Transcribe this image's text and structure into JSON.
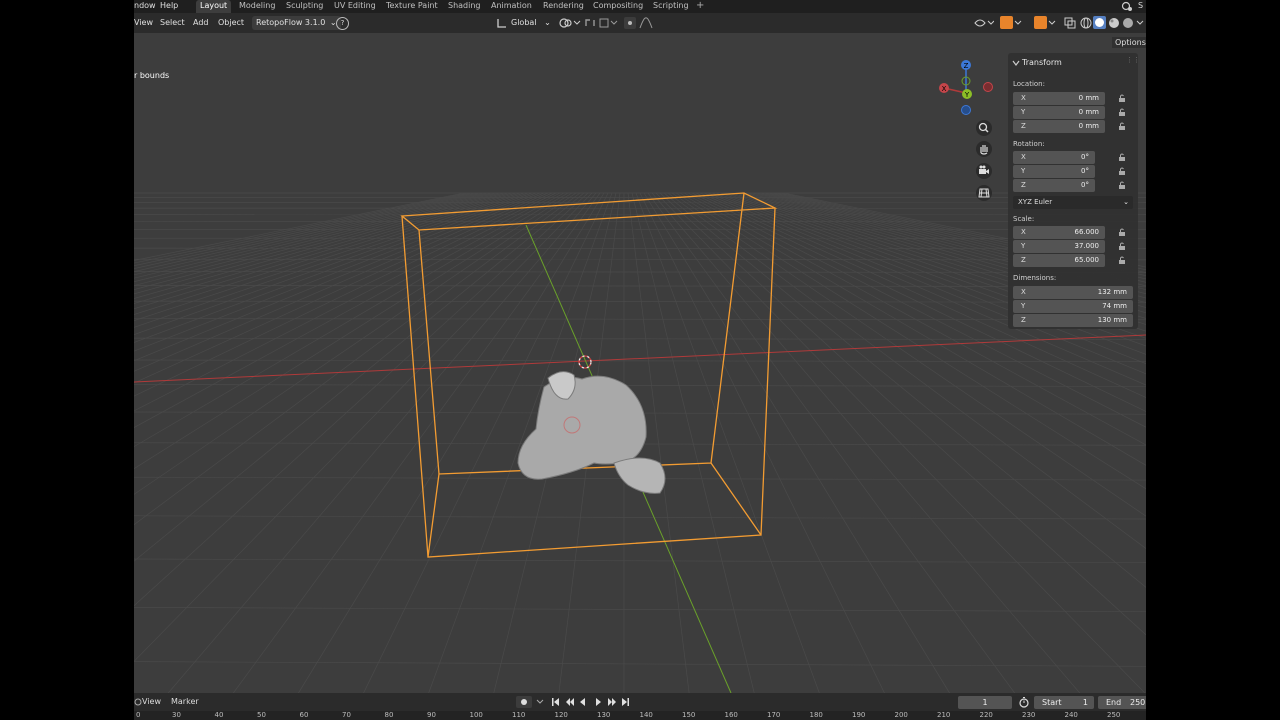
{
  "topbar": {
    "menus": [
      "ndow",
      "Help"
    ],
    "workspaces": [
      "Layout",
      "Modeling",
      "Sculpting",
      "UV Editing",
      "Texture Paint",
      "Shading",
      "Animation",
      "Rendering",
      "Compositing",
      "Scripting"
    ],
    "active_workspace": "Layout",
    "add_tab": "+",
    "edge_char": "S"
  },
  "header": {
    "menus": [
      "View",
      "Select",
      "Add",
      "Object"
    ],
    "addon_menu": "RetopoFlow 3.1.0",
    "help_glyph": "?",
    "orientation": "Global",
    "options_label": "Options"
  },
  "viewport": {
    "overlay_text": "r bounds",
    "gizmo_axes": [
      "X",
      "Y",
      "Z"
    ]
  },
  "npanel": {
    "title": "Transform",
    "location_label": "Location:",
    "location": [
      {
        "axis": "X",
        "value": "0 mm"
      },
      {
        "axis": "Y",
        "value": "0 mm"
      },
      {
        "axis": "Z",
        "value": "0 mm"
      }
    ],
    "rotation_label": "Rotation:",
    "rotation": [
      {
        "axis": "X",
        "value": "0°"
      },
      {
        "axis": "Y",
        "value": "0°"
      },
      {
        "axis": "Z",
        "value": "0°"
      }
    ],
    "rotation_mode": "XYZ Euler",
    "scale_label": "Scale:",
    "scale": [
      {
        "axis": "X",
        "value": "66.000"
      },
      {
        "axis": "Y",
        "value": "37.000"
      },
      {
        "axis": "Z",
        "value": "65.000"
      }
    ],
    "dimensions_label": "Dimensions:",
    "dimensions": [
      {
        "axis": "X",
        "value": "132 mm"
      },
      {
        "axis": "Y",
        "value": "74 mm"
      },
      {
        "axis": "Z",
        "value": "130 mm"
      }
    ]
  },
  "timeline": {
    "menus": [
      "View",
      "Marker"
    ],
    "current_frame": "1",
    "start_label": "Start",
    "start_value": "1",
    "end_label": "End",
    "end_value": "250",
    "ruler_ticks": [
      "0",
      "30",
      "40",
      "50",
      "60",
      "70",
      "80",
      "90",
      "100",
      "110",
      "120",
      "130",
      "140",
      "150",
      "160",
      "170",
      "180",
      "190",
      "200",
      "210",
      "220",
      "230",
      "240",
      "250"
    ]
  },
  "colors": {
    "selection_outline": "#f39c32",
    "x_axis": "#b03a3a",
    "y_axis": "#6aa12a",
    "z_axis": "#3c78d8",
    "viewport_bg": "#3d3d3d"
  }
}
